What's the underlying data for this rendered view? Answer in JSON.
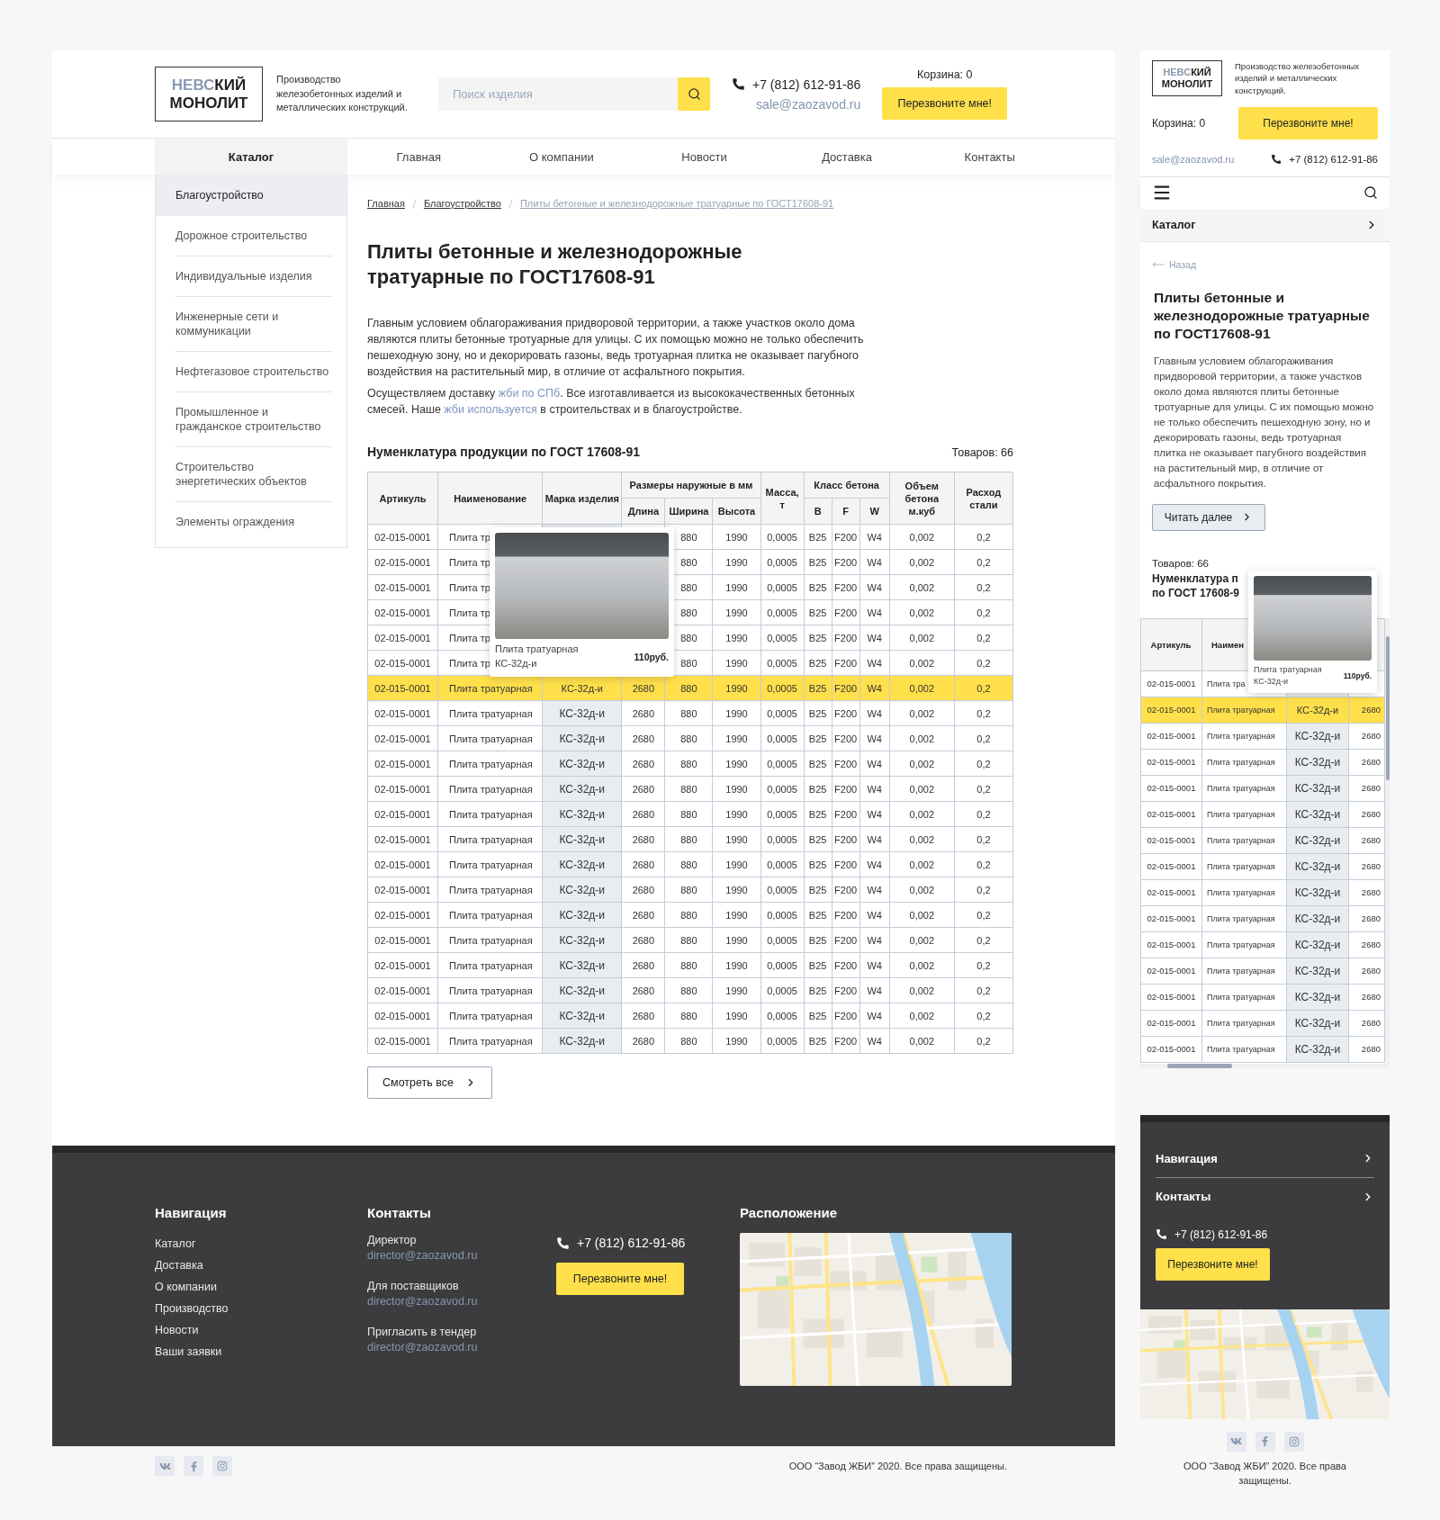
{
  "desktop": {
    "logo": {
      "accent": "НЕВС",
      "rest": "КИЙ",
      "line2": "МОНОЛИТ"
    },
    "tagline": "Производство железобетонных изделий и металлических конструкций.",
    "search": {
      "placeholder": "Поиск изделия"
    },
    "phone": "+7 (812) 612-91-86",
    "email": "sale@zaozavod.ru",
    "cart": "Корзина: 0",
    "callback": "Перезвоните мне!",
    "nav": [
      {
        "label": "Каталог",
        "selected": true
      },
      {
        "label": "Главная",
        "selected": false
      },
      {
        "label": "О компании",
        "selected": false
      },
      {
        "label": "Новости",
        "selected": false
      },
      {
        "label": "Доставка",
        "selected": false
      },
      {
        "label": "Контакты",
        "selected": false
      }
    ],
    "sidebar": [
      {
        "label": "Благоустройство",
        "selected": true
      },
      {
        "label": "Дорожное строительство",
        "selected": false
      },
      {
        "label": "Индивидуальные изделия",
        "selected": false
      },
      {
        "label": "Инженерные сети и коммуникации",
        "selected": false
      },
      {
        "label": "Нефтегазовое строительство",
        "selected": false
      },
      {
        "label": "Промышленное и гражданское строительство",
        "selected": false
      },
      {
        "label": "Строительство энергетических объектов",
        "selected": false
      },
      {
        "label": "Элементы ограждения",
        "selected": false
      }
    ],
    "breadcrumbs": [
      {
        "label": "Главная",
        "current": false
      },
      {
        "label": "Благоустройство",
        "current": false
      },
      {
        "label": "Плиты бетонные и железнодорожные тратуарные по ГОСТ17608-91",
        "current": true
      }
    ],
    "title": "Плиты бетонные и железнодорожные тратуарные по ГОСТ17608-91",
    "paragraphs": [
      [
        {
          "text": "Главным условием облагораживания придворовой территории, а также участков около дома являются плиты бетонные тротуарные для улицы. С их помощью можно не только обеспечить пешеходную зону, но и декорировать газоны, ведь тротуарная плитка не оказывает пагубного воздействия на растительный мир, в отличие от асфальтного покрытия.",
          "link": false
        }
      ],
      [
        {
          "text": "Осуществляем доставку ",
          "link": false
        },
        {
          "text": "жби по СПб",
          "link": true
        },
        {
          "text": ". Все изготавливается из высококачественных бетонных смесей. Наше ",
          "link": false
        },
        {
          "text": "жби используется",
          "link": true
        },
        {
          "text": " в строительствах и в благоустройстве.",
          "link": false
        }
      ]
    ],
    "table_title": "Нуменклатура продукции по ГОСТ 17608-91",
    "count": "Товаров: 66",
    "table": {
      "header_rows": [
        [
          {
            "label": "Артикуль",
            "rowspan": 2
          },
          {
            "label": "Наименование",
            "rowspan": 2
          },
          {
            "label": "Марка изделия",
            "rowspan": 2
          },
          {
            "label": "Размеры наружные в мм",
            "colspan": 3
          },
          {
            "label": "Масса, т",
            "rowspan": 2
          },
          {
            "label": "Класс бетона",
            "colspan": 3
          },
          {
            "label": "Объем бетона м.куб",
            "rowspan": 2
          },
          {
            "label": "Расход стали",
            "rowspan": 2
          }
        ],
        [
          {
            "label": "Длина"
          },
          {
            "label": "Ширина"
          },
          {
            "label": "Высота"
          },
          {
            "label": "B"
          },
          {
            "label": "F"
          },
          {
            "label": "W"
          }
        ]
      ],
      "rows": [
        {
          "selected": false,
          "cells": [
            "02-015-0001",
            "Плита тр",
            null,
            null,
            "880",
            "1990",
            "0,0005",
            "B25",
            "F200",
            "W4",
            "0,002",
            "0,2"
          ]
        },
        {
          "selected": false,
          "cells": [
            "02-015-0001",
            "Плита тр",
            null,
            null,
            "880",
            "1990",
            "0,0005",
            "B25",
            "F200",
            "W4",
            "0,002",
            "0,2"
          ]
        },
        {
          "selected": false,
          "cells": [
            "02-015-0001",
            "Плита тр",
            null,
            null,
            "880",
            "1990",
            "0,0005",
            "B25",
            "F200",
            "W4",
            "0,002",
            "0,2"
          ]
        },
        {
          "selected": false,
          "cells": [
            "02-015-0001",
            "Плита тр",
            null,
            null,
            "880",
            "1990",
            "0,0005",
            "B25",
            "F200",
            "W4",
            "0,002",
            "0,2"
          ]
        },
        {
          "selected": false,
          "cells": [
            "02-015-0001",
            "Плита тр",
            null,
            null,
            "880",
            "1990",
            "0,0005",
            "B25",
            "F200",
            "W4",
            "0,002",
            "0,2"
          ]
        },
        {
          "selected": false,
          "cells": [
            "02-015-0001",
            "Плита тр",
            null,
            null,
            "880",
            "1990",
            "0,0005",
            "B25",
            "F200",
            "W4",
            "0,002",
            "0,2"
          ]
        },
        {
          "selected": true,
          "cells": [
            "02-015-0001",
            "Плита тратуарная",
            "КС-32д-и",
            "2680",
            "880",
            "1990",
            "0,0005",
            "B25",
            "F200",
            "W4",
            "0,002",
            "0,2"
          ]
        },
        {
          "selected": false,
          "cells": [
            "02-015-0001",
            "Плита тратуарная",
            "КС-32д-и",
            "2680",
            "880",
            "1990",
            "0,0005",
            "B25",
            "F200",
            "W4",
            "0,002",
            "0,2"
          ]
        },
        {
          "selected": false,
          "cells": [
            "02-015-0001",
            "Плита тратуарная",
            "КС-32д-и",
            "2680",
            "880",
            "1990",
            "0,0005",
            "B25",
            "F200",
            "W4",
            "0,002",
            "0,2"
          ]
        },
        {
          "selected": false,
          "cells": [
            "02-015-0001",
            "Плита тратуарная",
            "КС-32д-и",
            "2680",
            "880",
            "1990",
            "0,0005",
            "B25",
            "F200",
            "W4",
            "0,002",
            "0,2"
          ]
        },
        {
          "selected": false,
          "cells": [
            "02-015-0001",
            "Плита тратуарная",
            "КС-32д-и",
            "2680",
            "880",
            "1990",
            "0,0005",
            "B25",
            "F200",
            "W4",
            "0,002",
            "0,2"
          ]
        },
        {
          "selected": false,
          "cells": [
            "02-015-0001",
            "Плита тратуарная",
            "КС-32д-и",
            "2680",
            "880",
            "1990",
            "0,0005",
            "B25",
            "F200",
            "W4",
            "0,002",
            "0,2"
          ]
        },
        {
          "selected": false,
          "cells": [
            "02-015-0001",
            "Плита тратуарная",
            "КС-32д-и",
            "2680",
            "880",
            "1990",
            "0,0005",
            "B25",
            "F200",
            "W4",
            "0,002",
            "0,2"
          ]
        },
        {
          "selected": false,
          "cells": [
            "02-015-0001",
            "Плита тратуарная",
            "КС-32д-и",
            "2680",
            "880",
            "1990",
            "0,0005",
            "B25",
            "F200",
            "W4",
            "0,002",
            "0,2"
          ]
        },
        {
          "selected": false,
          "cells": [
            "02-015-0001",
            "Плита тратуарная",
            "КС-32д-и",
            "2680",
            "880",
            "1990",
            "0,0005",
            "B25",
            "F200",
            "W4",
            "0,002",
            "0,2"
          ]
        },
        {
          "selected": false,
          "cells": [
            "02-015-0001",
            "Плита тратуарная",
            "КС-32д-и",
            "2680",
            "880",
            "1990",
            "0,0005",
            "B25",
            "F200",
            "W4",
            "0,002",
            "0,2"
          ]
        },
        {
          "selected": false,
          "cells": [
            "02-015-0001",
            "Плита тратуарная",
            "КС-32д-и",
            "2680",
            "880",
            "1990",
            "0,0005",
            "B25",
            "F200",
            "W4",
            "0,002",
            "0,2"
          ]
        },
        {
          "selected": false,
          "cells": [
            "02-015-0001",
            "Плита тратуарная",
            "КС-32д-и",
            "2680",
            "880",
            "1990",
            "0,0005",
            "B25",
            "F200",
            "W4",
            "0,002",
            "0,2"
          ]
        },
        {
          "selected": false,
          "cells": [
            "02-015-0001",
            "Плита тратуарная",
            "КС-32д-и",
            "2680",
            "880",
            "1990",
            "0,0005",
            "B25",
            "F200",
            "W4",
            "0,002",
            "0,2"
          ]
        },
        {
          "selected": false,
          "cells": [
            "02-015-0001",
            "Плита тратуарная",
            "КС-32д-и",
            "2680",
            "880",
            "1990",
            "0,0005",
            "B25",
            "F200",
            "W4",
            "0,002",
            "0,2"
          ]
        },
        {
          "selected": false,
          "cells": [
            "02-015-0001",
            "Плита тратуарная",
            "КС-32д-и",
            "2680",
            "880",
            "1990",
            "0,0005",
            "B25",
            "F200",
            "W4",
            "0,002",
            "0,2"
          ]
        }
      ]
    },
    "tooltip": {
      "name": "Плита тратуарная КС-32д-и",
      "price": "110руб."
    },
    "more_button": "Смотреть все",
    "footer": {
      "nav_title": "Навигация",
      "nav": [
        "Каталог",
        "Доставка",
        "О компании",
        "Производство",
        "Новости",
        "Ваши заявки"
      ],
      "contacts_title": "Контакты",
      "contacts": [
        {
          "label": "Директор",
          "email": "director@zaozavod.ru"
        },
        {
          "label": "Для поставщиков",
          "email": "director@zaozavod.ru"
        },
        {
          "label": "Пригласить в тендер",
          "email": "director@zaozavod.ru"
        }
      ],
      "phone": "+7 (812) 612-91-86",
      "callback": "Перезвоните мне!",
      "location_title": "Расположение"
    },
    "copyright": "ООО “Завод ЖБИ” 2020. Все права защищены."
  },
  "mobile": {
    "logo": {
      "accent": "НЕВС",
      "rest": "КИЙ",
      "line2": "МОНОЛИТ"
    },
    "tagline": "Производство железобетонных изделий и металлических конструкций.",
    "cart": "Корзина: 0",
    "callback": "Перезвоните мне!",
    "email": "sale@zaozavod.ru",
    "phone": "+7 (812) 612-91-86",
    "catalog": "Каталог",
    "back": "Назад",
    "title": "Плиты бетонные и железнодорожные тратуарные по ГОСТ17608-91",
    "paragraph": "Главным условием облагораживания придворовой территории, а также участков около дома являются плиты бетонные тротуарные для улицы. С их помощью можно не только обеспечить пешеходную зону, но и декорировать газоны, ведь тротуарная плитка не оказывает пагубного воздействия на растительный мир, в отличие от асфальтного покрытия.",
    "read_more": "Читать далее",
    "count": "Товаров: 66",
    "table_title": [
      "Нуменклатура п",
      "по ГОСТ 17608-9"
    ],
    "table": {
      "columns": [
        "Артикуль",
        "Наимен"
      ],
      "rows": [
        {
          "selected": false,
          "cells": [
            "02-015-0001",
            "Плита тра",
            null,
            null
          ]
        },
        {
          "selected": true,
          "cells": [
            "02-015-0001",
            "Плита тратуарная",
            "КС-32д-и",
            "2680"
          ]
        },
        {
          "selected": false,
          "cells": [
            "02-015-0001",
            "Плита тратуарная",
            "КС-32д-и",
            "2680"
          ]
        },
        {
          "selected": false,
          "cells": [
            "02-015-0001",
            "Плита тратуарная",
            "КС-32д-и",
            "2680"
          ]
        },
        {
          "selected": false,
          "cells": [
            "02-015-0001",
            "Плита тратуарная",
            "КС-32д-и",
            "2680"
          ]
        },
        {
          "selected": false,
          "cells": [
            "02-015-0001",
            "Плита тратуарная",
            "КС-32д-и",
            "2680"
          ]
        },
        {
          "selected": false,
          "cells": [
            "02-015-0001",
            "Плита тратуарная",
            "КС-32д-и",
            "2680"
          ]
        },
        {
          "selected": false,
          "cells": [
            "02-015-0001",
            "Плита тратуарная",
            "КС-32д-и",
            "2680"
          ]
        },
        {
          "selected": false,
          "cells": [
            "02-015-0001",
            "Плита тратуарная",
            "КС-32д-и",
            "2680"
          ]
        },
        {
          "selected": false,
          "cells": [
            "02-015-0001",
            "Плита тратуарная",
            "КС-32д-и",
            "2680"
          ]
        },
        {
          "selected": false,
          "cells": [
            "02-015-0001",
            "Плита тратуарная",
            "КС-32д-и",
            "2680"
          ]
        },
        {
          "selected": false,
          "cells": [
            "02-015-0001",
            "Плита тратуарная",
            "КС-32д-и",
            "2680"
          ]
        },
        {
          "selected": false,
          "cells": [
            "02-015-0001",
            "Плита тратуарная",
            "КС-32д-и",
            "2680"
          ]
        },
        {
          "selected": false,
          "cells": [
            "02-015-0001",
            "Плита тратуарная",
            "КС-32д-и",
            "2680"
          ]
        },
        {
          "selected": false,
          "cells": [
            "02-015-0001",
            "Плита тратуарная",
            "КС-32д-и",
            "2680"
          ]
        }
      ]
    },
    "tooltip": {
      "name": "Плита тратуарная КС-32д-и",
      "price": "110руб."
    },
    "footer": {
      "sections": [
        "Навигация",
        "Контакты"
      ],
      "phone": "+7 (812) 612-91-86",
      "callback": "Перезвоните мне!"
    },
    "copyright": "ООО “Завод ЖБИ” 2020. Все права защищены."
  }
}
